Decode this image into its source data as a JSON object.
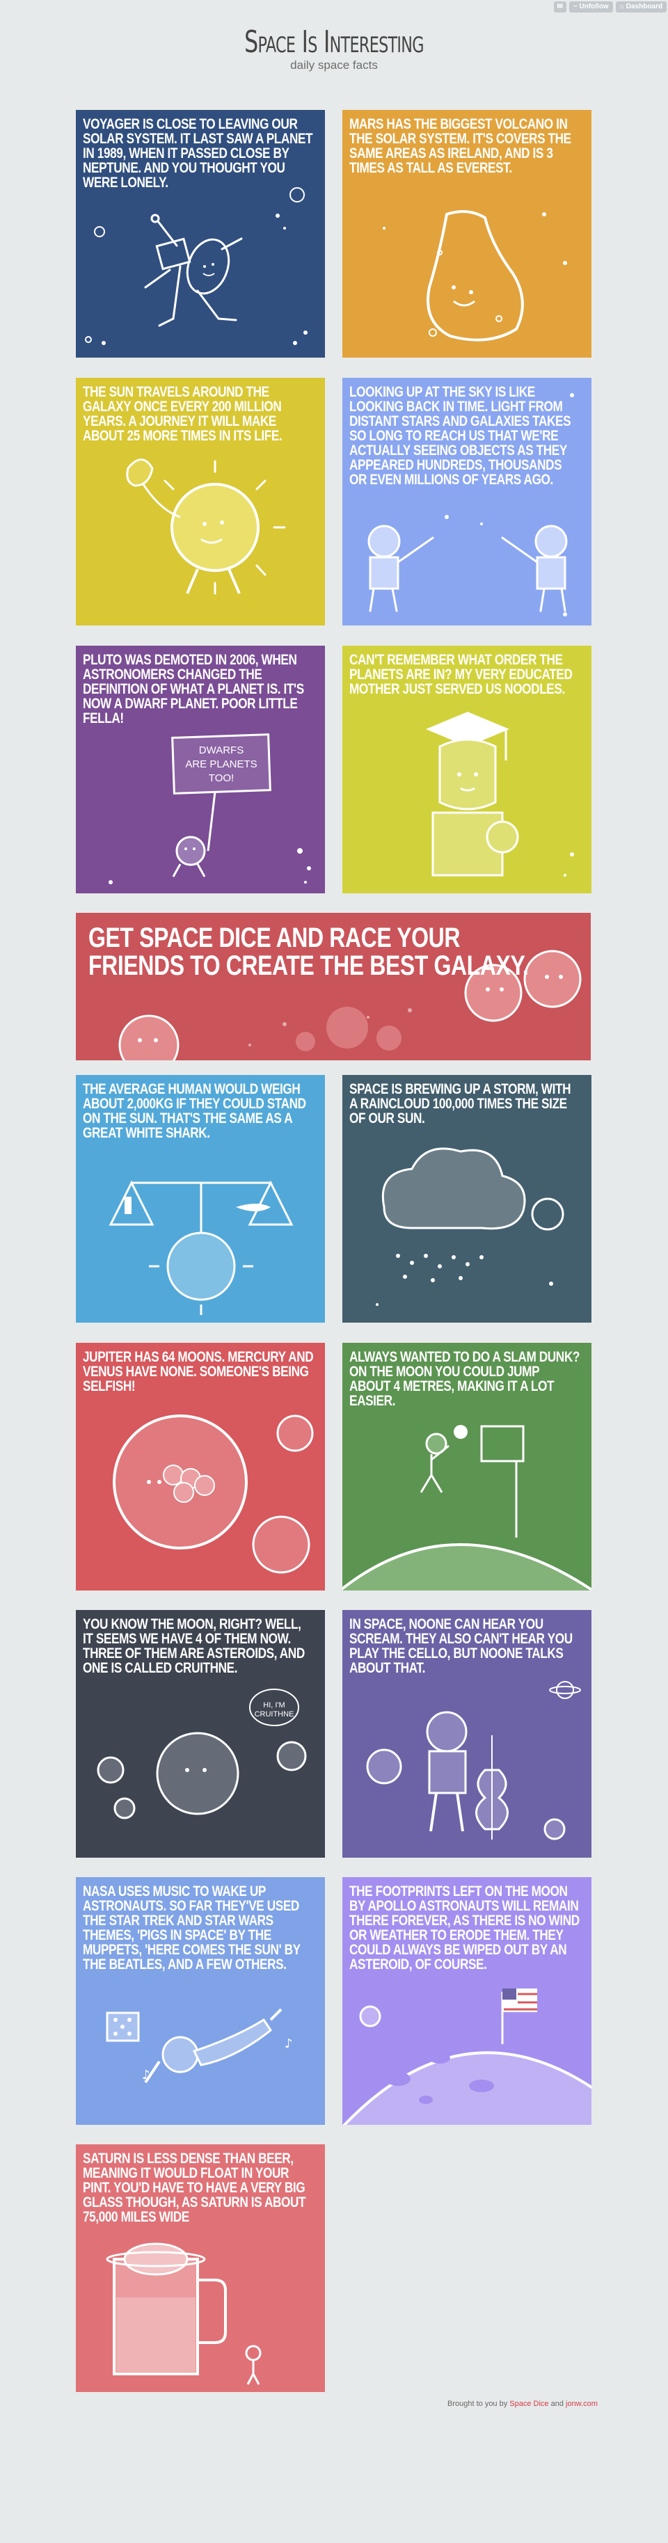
{
  "tumblr": {
    "message_icon": "mail-icon",
    "unfollow": "Unfollow",
    "dashboard": "Dashboard"
  },
  "header": {
    "title": "Space Is Interesting",
    "subtitle": "daily space facts"
  },
  "colors": {
    "navy": "#304f7f",
    "orange": "#e2a33c",
    "yellow": "#d9c734",
    "periwinkle": "#8aa6f0",
    "purple": "#7a4d95",
    "lime": "#d1d23b",
    "red": "#c9545a",
    "sky": "#52a9d9",
    "slate": "#435f6e",
    "coral": "#d7585d",
    "green": "#5c9451",
    "charcoal": "#3e4450",
    "violet": "#6b63a6",
    "cornflower": "#7fa3e6",
    "lavender": "#a48ff0",
    "salmon": "#e07277"
  },
  "tiles": [
    {
      "text": "Voyager is close to leaving our solar system. It last saw a planet in 1989, when it passed close by Neptune. And you thought you were lonely.",
      "illustration": "voyager-probe-icon"
    },
    {
      "text": "Mars has the biggest volcano in the solar system. It's covers the same areas as Ireland, and is 3 times as tall as Everest.",
      "illustration": "volcano-icon"
    },
    {
      "text": "The sun travels around the galaxy once every 200 million years. A journey it will make about 25 more times in its life.",
      "illustration": "sun-icon"
    },
    {
      "text": "Looking up at the sky is like looking back in time. Light from distant stars and galaxies takes so long to reach us that we're actually seeing objects as they appeared hundreds, thousands or even millions of years ago.",
      "illustration": "people-pointing-icon"
    },
    {
      "text": "Pluto was demoted in 2006, when astronomers changed the definition of what a planet is. It's now a dwarf planet. Poor little fella!",
      "illustration": "pluto-sign-icon",
      "sign": "Dwarfs are planets too!"
    },
    {
      "text": "Can't remember what order the planets are in? My very educated mother just served us noodles.",
      "illustration": "graduate-icon"
    },
    {
      "text": "The average human would weigh about 2,000kg if they could stand on the sun. That's the same as a great white shark.",
      "illustration": "scale-icon"
    },
    {
      "text": "Space is brewing up a storm, with a raincloud 100,000 times the size of our sun.",
      "illustration": "raincloud-icon"
    },
    {
      "text": "Jupiter has 64 moons. Mercury and Venus have none. Someone's being selfish!",
      "illustration": "jupiter-icon"
    },
    {
      "text": "Always wanted to do a slam dunk? On the moon you could jump about 4 metres, making it a lot easier.",
      "illustration": "basketball-icon"
    },
    {
      "text": "You know the moon, right? Well, it seems we have 4 of them now. Three of them are asteroids, and one is called Cruithne.",
      "illustration": "moons-icon",
      "bubble": "Hi, I'm Cruithne"
    },
    {
      "text": "In space, noone can hear you scream. They also can't hear you play the cello, but noone talks about that.",
      "illustration": "astronaut-cello-icon"
    },
    {
      "text": "NASA uses music to wake up astronauts. So far they've used the Star Trek and Star Wars themes, 'Pigs in space' by the muppets, 'Here comes the sun' by the Beatles, and a few others.",
      "illustration": "floating-astronaut-icon"
    },
    {
      "text": "The footprints left on the moon by Apollo astronauts will remain there forever, as there is no wind or weather to erode them. They could always be wiped out by an asteroid, of course.",
      "illustration": "moon-flag-icon"
    },
    {
      "text": "Saturn is less dense than beer, meaning it would float in your pint. You'd have to have a very big glass though, as Saturn is about 75,000 miles wide",
      "illustration": "beer-saturn-icon"
    }
  ],
  "promo": {
    "text": "Get Space Dice and race your friends to create the best galaxy."
  },
  "footer": {
    "prefix": "Brought to you by",
    "link1": "Space Dice",
    "and": "and",
    "link2": "jonw.com"
  }
}
